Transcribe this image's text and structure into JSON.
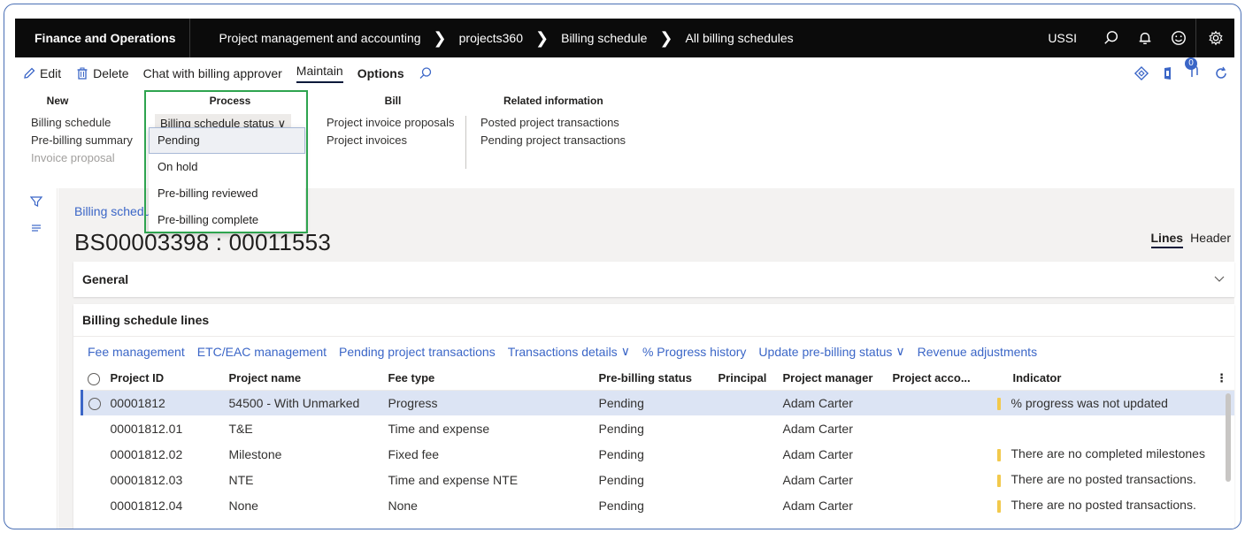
{
  "topnav": {
    "app_title": "Finance and Operations",
    "breadcrumbs": [
      "Project management and accounting",
      "projects360",
      "Billing schedule",
      "All billing schedules"
    ],
    "company": "USSI",
    "icons": [
      "search-icon",
      "bell-icon",
      "smiley-icon",
      "gear-icon"
    ]
  },
  "actionbar": {
    "edit": "Edit",
    "delete": "Delete",
    "chat": "Chat with billing approver",
    "tab_maintain": "Maintain",
    "tab_options": "Options",
    "notification_count": "0"
  },
  "ribbon": {
    "new": {
      "title": "New",
      "items": [
        "Billing schedule",
        "Pre-billing summary",
        "Invoice proposal"
      ]
    },
    "process": {
      "title": "Process",
      "dropdown_label": "Billing schedule status"
    },
    "bill": {
      "title": "Bill",
      "items": [
        "Project invoice proposals",
        "Project invoices"
      ]
    },
    "related": {
      "title": "Related information",
      "items": [
        "Posted project transactions",
        "Pending project transactions"
      ]
    }
  },
  "status_menu": {
    "options": [
      "Pending",
      "On hold",
      "Pre-billing reviewed",
      "Pre-billing complete"
    ],
    "selected": "Pending"
  },
  "page": {
    "breadcrumb": "Billing schedu",
    "title": "BS00003398 : 00011553",
    "view_lines": "Lines",
    "view_header": "Header"
  },
  "general": {
    "title": "General"
  },
  "lines": {
    "title": "Billing schedule lines",
    "actions": [
      "Fee management",
      "ETC/EAC management",
      "Pending project transactions",
      "Transactions details",
      "% Progress history",
      "Update pre-billing status",
      "Revenue adjustments"
    ],
    "columns": [
      "Project ID",
      "Project name",
      "Fee type",
      "Pre-billing status",
      "Principal",
      "Project manager",
      "Project acco...",
      "Indicator"
    ],
    "rows": [
      {
        "id": "00001812",
        "name": "54500 - With Unmarked",
        "fee": "Progress",
        "status": "Pending",
        "principal": "",
        "manager": "Adam Carter",
        "acct": "",
        "indicator": "% progress was not updated",
        "warn": true
      },
      {
        "id": "00001812.01",
        "name": "T&E",
        "fee": "Time and expense",
        "status": "Pending",
        "principal": "",
        "manager": "Adam Carter",
        "acct": "",
        "indicator": "",
        "warn": false
      },
      {
        "id": "00001812.02",
        "name": "Milestone",
        "fee": "Fixed fee",
        "status": "Pending",
        "principal": "",
        "manager": "Adam Carter",
        "acct": "",
        "indicator": "There are no completed milestones",
        "warn": true
      },
      {
        "id": "00001812.03",
        "name": "NTE",
        "fee": "Time and expense NTE",
        "status": "Pending",
        "principal": "",
        "manager": "Adam Carter",
        "acct": "",
        "indicator": "There are no posted transactions.",
        "warn": true
      },
      {
        "id": "00001812.04",
        "name": "None",
        "fee": "None",
        "status": "Pending",
        "principal": "",
        "manager": "Adam Carter",
        "acct": "",
        "indicator": "There are no posted transactions.",
        "warn": true
      }
    ]
  },
  "colors": {
    "nav_bg": "#0b0b0b",
    "link": "#3b66c7",
    "highlight_border": "#2ea44f",
    "selected_row": "#dce4f4",
    "warning": "#f2c94c"
  }
}
